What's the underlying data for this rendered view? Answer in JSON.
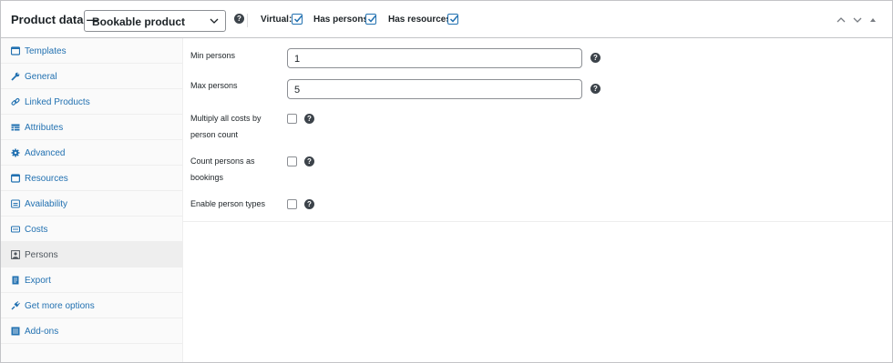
{
  "header": {
    "title": "Product data —",
    "product_type": "Bookable product",
    "help": "?",
    "virtual_label": "Virtual:",
    "has_persons_label": "Has persons:",
    "has_resources_label": "Has resources:",
    "virtual_checked": true,
    "has_persons_checked": true,
    "has_resources_checked": true,
    "arrows": [
      "⌃",
      "⌄",
      "▴"
    ]
  },
  "sidebar": {
    "items": [
      {
        "label": "Templates",
        "icon": "templates-icon"
      },
      {
        "label": "General",
        "icon": "wrench-icon"
      },
      {
        "label": "Linked Products",
        "icon": "link-icon"
      },
      {
        "label": "Attributes",
        "icon": "table-icon"
      },
      {
        "label": "Advanced",
        "icon": "gear-icon"
      },
      {
        "label": "Resources",
        "icon": "resources-icon"
      },
      {
        "label": "Availability",
        "icon": "calendar-icon"
      },
      {
        "label": "Costs",
        "icon": "money-icon"
      },
      {
        "label": "Persons",
        "icon": "person-icon"
      },
      {
        "label": "Export",
        "icon": "export-icon"
      },
      {
        "label": "Get more options",
        "icon": "plugin-icon"
      },
      {
        "label": "Add-ons",
        "icon": "list-icon"
      }
    ],
    "active_index": 8
  },
  "fields": {
    "min_label": "Min persons",
    "min_value": "1",
    "max_label": "Max persons",
    "max_value": "5",
    "multiply_label_1": "Multiply all costs by",
    "multiply_label_2": "person count",
    "count_label_1": "Count persons as",
    "count_label_2": "bookings",
    "enable_label": "Enable person types",
    "help": "?"
  },
  "colors": {
    "link": "#2271b1",
    "border": "#c3c4c7",
    "active_tab": "#eeeeee"
  }
}
